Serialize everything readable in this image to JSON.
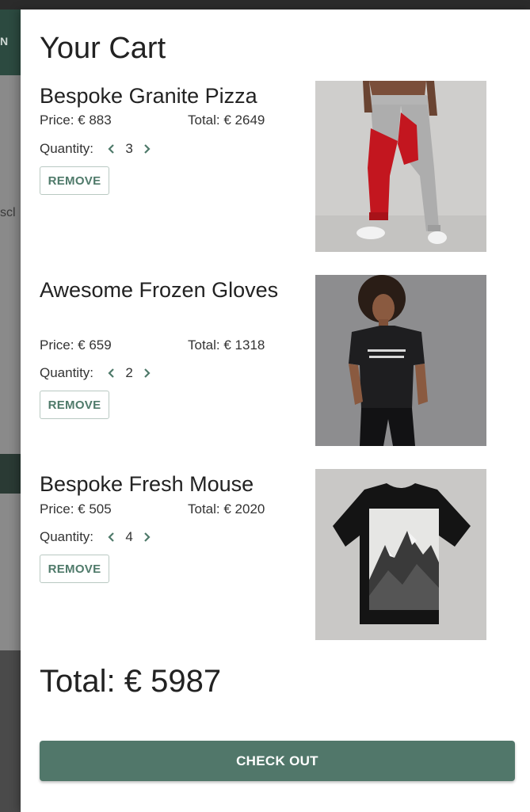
{
  "background": {
    "header_letter": "N",
    "side_text": "scl"
  },
  "cart": {
    "title": "Your Cart",
    "quantity_label": "Quantity:",
    "remove_label": "REMOVE",
    "items": [
      {
        "name": "Bespoke Granite Pizza",
        "price": "Price: € 883",
        "total": "Total: € 2649",
        "quantity": "3",
        "image": "pants-photo"
      },
      {
        "name": "Awesome Frozen Gloves",
        "price": "Price: € 659",
        "total": "Total: € 1318",
        "quantity": "2",
        "image": "tshirt-model-photo"
      },
      {
        "name": "Bespoke Fresh Mouse",
        "price": "Price: € 505",
        "total": "Total: € 2020",
        "quantity": "4",
        "image": "mountain-tshirt-photo"
      }
    ],
    "grand_total": "Total: € 5987",
    "checkout_label": "CHECK OUT"
  },
  "colors": {
    "accent": "#51776a",
    "remove_text": "#4f7a6a",
    "header_bg": "#2c4a40"
  }
}
